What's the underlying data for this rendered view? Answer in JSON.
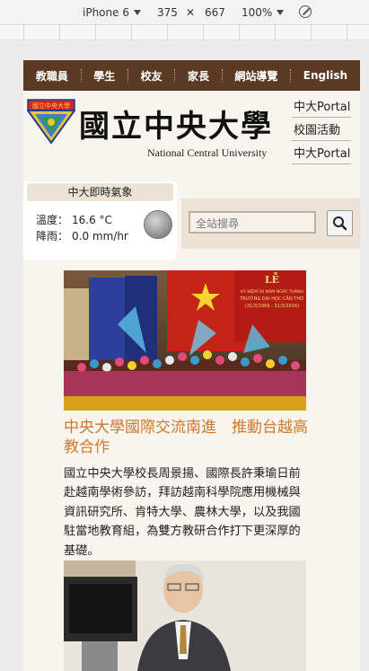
{
  "devtools": {
    "device": "iPhone 6",
    "width": "375",
    "height": "667",
    "zoom": "100%"
  },
  "nav": {
    "items": [
      "教職員",
      "學生",
      "校友",
      "家長",
      "網站導覽",
      "English"
    ]
  },
  "brand": {
    "name_zh": "國立中央大學",
    "name_en": "National Central University",
    "logo_text": "國立中央大學"
  },
  "portals": [
    "中大Portal",
    "校園活動",
    "中大Portal"
  ],
  "weather": {
    "title": "中大即時氣象",
    "temp_label": "溫度：",
    "temp_value": "16.6 °C",
    "rain_label": "降雨：",
    "rain_value": "0.0 mm/hr"
  },
  "search": {
    "placeholder": "全站搜尋"
  },
  "news": {
    "banner": {
      "line1": "KỶ NIỆM 50 NĂM NGÀY THÀNH",
      "line2": "TRƯỜNG ĐẠI HỌC CẦN THƠ",
      "line3": "(31/3/1966 - 31/3/2016)"
    },
    "title": "中央大學國際交流南進　推動台越高教合作",
    "body": "國立中央大學校長周景揚、國際長許秉瑜日前赴越南學術參訪，拜訪越南科學院應用機械與資訊研究所、肯特大學、農林大學，以及我國駐當地教育組，為雙方教研合作打下更深厚的基礎。"
  }
}
